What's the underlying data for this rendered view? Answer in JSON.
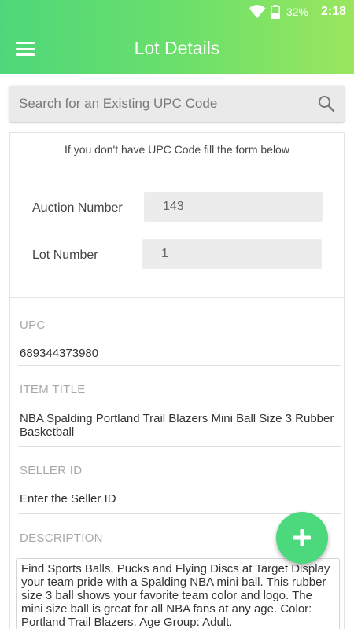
{
  "status_bar": {
    "battery_percent": "32%",
    "time": "2:18"
  },
  "app_bar": {
    "title": "Lot Details"
  },
  "search": {
    "placeholder": "Search for an Existing UPC Code"
  },
  "form": {
    "hint": "If you don't have UPC Code fill the form below",
    "auction_number": {
      "label": "Auction Number",
      "value": "143"
    },
    "lot_number": {
      "label": "Lot Number",
      "value": "1"
    },
    "upc": {
      "label": "UPC",
      "value": "689344373980"
    },
    "item_title": {
      "label": "ITEM TITLE",
      "value": "NBA Spalding Portland Trail Blazers Mini Ball Size 3 Rubber Basketball"
    },
    "seller_id": {
      "label": "SELLER ID",
      "placeholder": "Enter the Seller ID"
    },
    "description": {
      "label": "DESCRIPTION",
      "value": "Find Sports Balls, Pucks and Flying Discs at Target Display your team pride with a Spalding NBA mini ball. This rubber size 3 ball shows your favorite team color and logo. The mini size ball is great for all NBA fans at any age. Color: Portland Trail Blazers. Age Group: Adult."
    }
  },
  "colors": {
    "accent": "#4cd87c",
    "header_start": "#4ed77a",
    "header_end": "#9ae65e"
  },
  "icons": [
    "menu-icon",
    "search-icon",
    "wifi-icon",
    "battery-icon",
    "plus-icon"
  ]
}
